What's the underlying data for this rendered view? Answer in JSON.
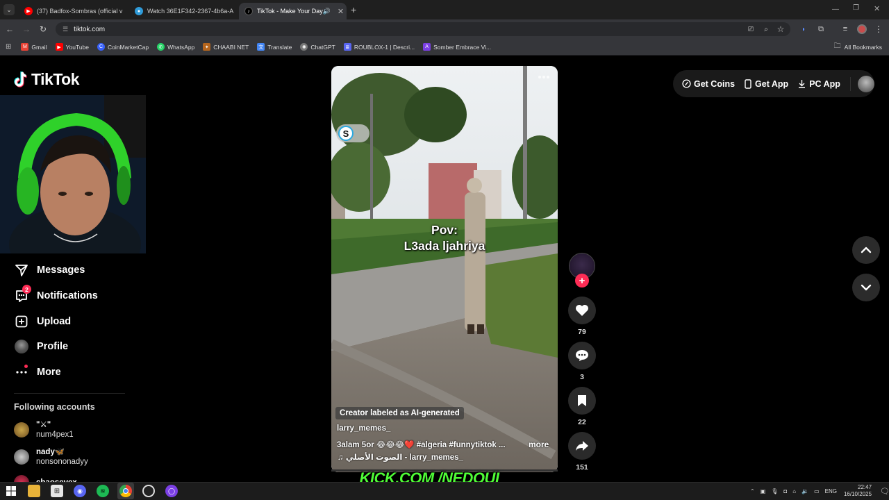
{
  "browser": {
    "tabs": [
      {
        "title": "(37) Badfox-Sombras (official v",
        "icon": "youtube-icon",
        "color": "#ff0000"
      },
      {
        "title": "Watch 36E1F342-2367-4b6a-A",
        "icon": "stream-icon",
        "color": "#2f9bd9"
      },
      {
        "title": "TikTok - Make Your Day",
        "icon": "tiktok-icon",
        "color": "#000000"
      }
    ],
    "url": "tiktok.com",
    "bookmarks": [
      {
        "label": "Gmail",
        "color": "#ea4335"
      },
      {
        "label": "YouTube",
        "color": "#ff0000"
      },
      {
        "label": "CoinMarketCap",
        "color": "#3861fb"
      },
      {
        "label": "WhatsApp",
        "color": "#25d366"
      },
      {
        "label": "CHAABI NET",
        "color": "#b5651d"
      },
      {
        "label": "Translate",
        "color": "#4285f4"
      },
      {
        "label": "ChatGPT",
        "color": "#777777"
      },
      {
        "label": "ROUBLOX-1 | Descri...",
        "color": "#5865f2"
      },
      {
        "label": "Somber Embrace Vi...",
        "color": "#7b3fe4"
      }
    ],
    "all_bookmarks": "All Bookmarks"
  },
  "tiktok": {
    "logo": "TikTok",
    "nav": {
      "messages": "Messages",
      "notifications": "Notifications",
      "notifications_badge": "2",
      "upload": "Upload",
      "profile": "Profile",
      "more": "More"
    },
    "following_title": "Following accounts",
    "following": [
      {
        "name": "\"⚔\"",
        "username": "num4pex1"
      },
      {
        "name": "nady🦋",
        "username": "nonsononadyy"
      },
      {
        "name": "chaosevex",
        "username": ""
      }
    ],
    "topbar": {
      "coins": "Get Coins",
      "app": "Get App",
      "pc": "PC App"
    },
    "video": {
      "caption_line1": "Pov:",
      "caption_line2": "L3ada ljahriya",
      "ai_label": "Creator labeled as AI-generated",
      "author": "larry_memes_",
      "description": "3alam 5or 😂😂😂❤️ #algeria #funnytiktok ...",
      "more": "more",
      "music": "♫  الصوت الأصلي - larry_memes_"
    },
    "actions": {
      "likes": "79",
      "comments": "3",
      "saves": "22",
      "shares": "151"
    },
    "overlay": "KICK.COM /NEDOUI"
  },
  "taskbar": {
    "lang": "ENG",
    "time": "22:47",
    "date": "16/10/2025"
  },
  "colors": {
    "tiktok_red": "#fe2c55",
    "kick_green": "#4ffc36"
  }
}
